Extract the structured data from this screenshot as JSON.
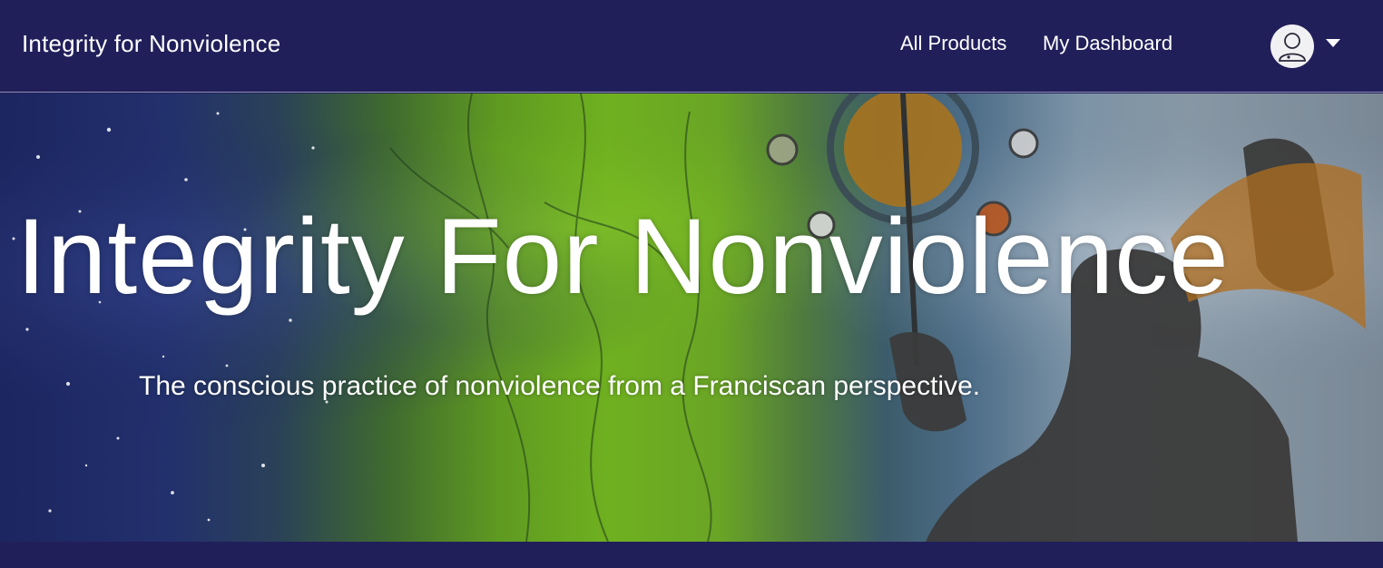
{
  "header": {
    "brand": "Integrity for Nonviolence",
    "nav": {
      "all_products": "All Products",
      "my_dashboard": "My Dashboard"
    },
    "user_menu": {
      "avatar_icon": "user-avatar-icon",
      "caret_icon": "caret-down-icon"
    }
  },
  "hero": {
    "title": "Integrity For Nonviolence",
    "subtitle": "The conscious practice of nonviolence from a Franciscan perspective."
  },
  "colors": {
    "nav_background": "#211f5a",
    "text": "#ffffff"
  }
}
